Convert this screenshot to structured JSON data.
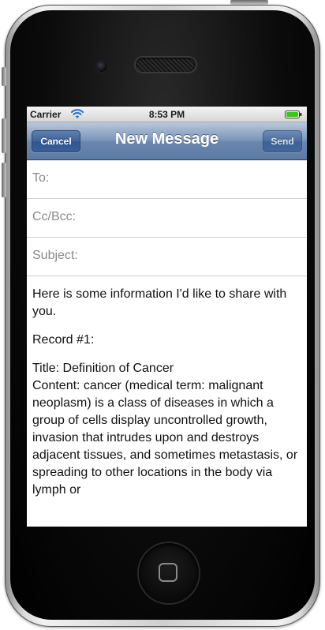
{
  "status_bar": {
    "carrier": "Carrier",
    "time": "8:53 PM",
    "battery_color": "#3cc421"
  },
  "nav": {
    "title": "New Message",
    "cancel_label": "Cancel",
    "send_label": "Send",
    "bar_color": "#6b87ad"
  },
  "fields": {
    "to_label": "To:",
    "cc_label": "Cc/Bcc:",
    "subject_label": "Subject:"
  },
  "message": {
    "intro": "Here is some information I'd like to share with you.",
    "record": "Record #1:",
    "title_line": "Title: Definition of Cancer",
    "content": "Content: cancer (medical term: malignant neoplasm) is a class of diseases in which a group of cells display uncontrolled growth, invasion that intrudes upon and destroys adjacent tissues, and sometimes metastasis, or spreading to other locations in the body via lymph or"
  },
  "icons": {
    "wifi": "wifi-icon",
    "battery": "battery-icon",
    "home": "home-button-icon"
  }
}
